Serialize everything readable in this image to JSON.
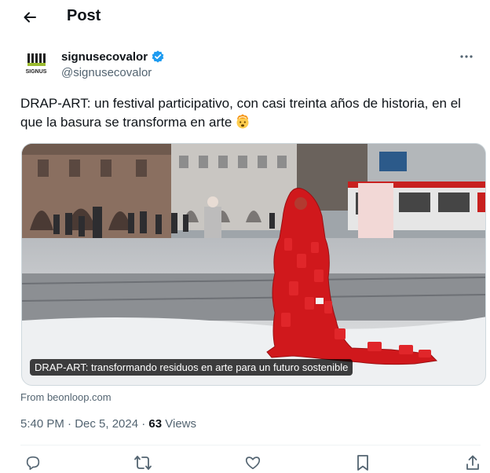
{
  "header": {
    "title": "Post",
    "back_icon": "arrow-left-icon"
  },
  "author": {
    "display_name": "signusecovalor",
    "handle": "@signusecovalor",
    "verified": true,
    "verified_color": "#1d9bf0",
    "avatar_text": "SIGNUS",
    "more_icon": "more-horizontal-icon"
  },
  "post": {
    "text": "DRAP-ART: un festival participativo, con casi treinta años de historia, en el que la basura se transforma en arte",
    "emoji": "exploding-head-emoji"
  },
  "media": {
    "caption": "DRAP-ART: transformando residuos en arte para un futuro sostenible"
  },
  "source": {
    "label": "From beonloop.com"
  },
  "meta": {
    "time_date": "5:40 PM · Dec 5, 2024 · ",
    "views_count": "63",
    "views_label": " Views"
  },
  "actions": {
    "items": [
      "reply-icon",
      "repost-icon",
      "like-icon",
      "bookmark-icon",
      "share-icon"
    ]
  },
  "colors": {
    "text_primary": "#0f1419",
    "text_secondary": "#536471",
    "accent": "#1d9bf0",
    "costume_red": "#d0181c"
  }
}
